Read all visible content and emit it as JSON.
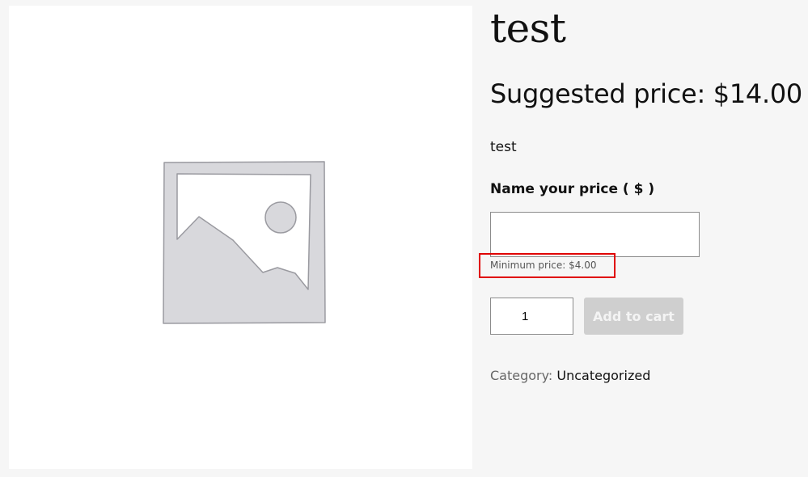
{
  "product": {
    "title": "test",
    "suggested_price": "Suggested price: $14.00",
    "description": "test"
  },
  "nyp": {
    "label": "Name your price ( $ )",
    "value": "",
    "minimum_text": "Minimum price: $4.00"
  },
  "cart": {
    "quantity": "1",
    "add_label": "Add to cart"
  },
  "meta": {
    "category_label": "Category:",
    "category_link": "Uncategorized"
  },
  "colors": {
    "highlight": "#e00000",
    "button_disabled": "#cfcfcf"
  },
  "icons": {
    "product_image": "image-placeholder-icon"
  }
}
